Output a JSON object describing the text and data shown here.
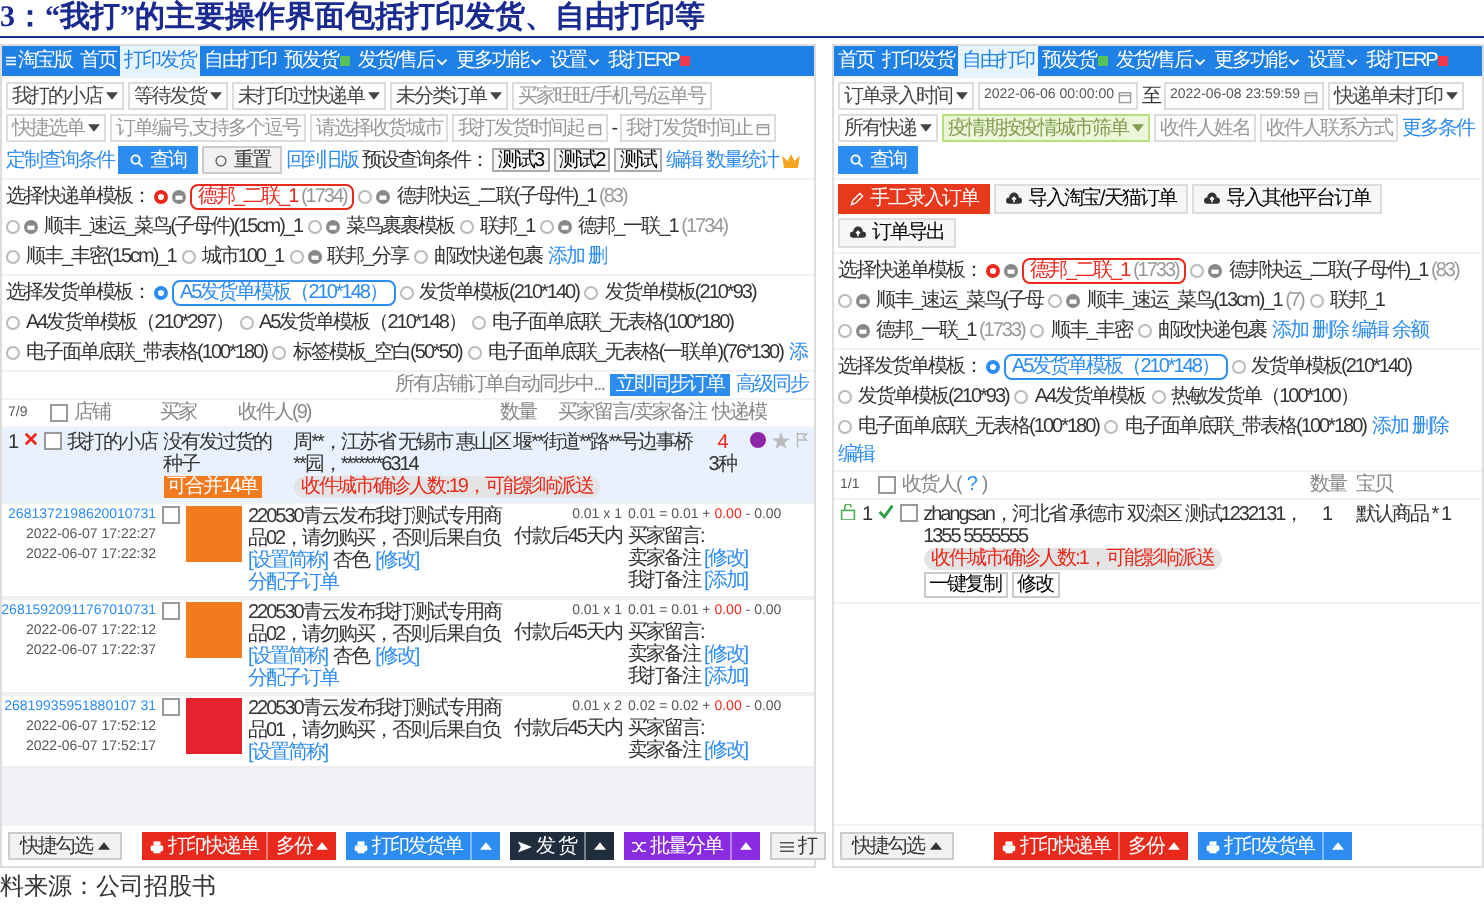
{
  "title": "3：“我打”的主要操作界面包括打印发货、自由打印等",
  "left": {
    "nav": {
      "logo": "淘宝版",
      "tabs": [
        {
          "label": "首页",
          "selected": false,
          "dropdown": false
        },
        {
          "label": "打印发货",
          "selected": true,
          "dropdown": false
        },
        {
          "label": "自由打印",
          "selected": false,
          "dropdown": false
        },
        {
          "label": "预发货",
          "selected": false,
          "dropdown": false,
          "badge": {
            "color": "#59c15a"
          }
        },
        {
          "label": "发货/售后",
          "selected": false,
          "dropdown": true
        },
        {
          "label": "更多功能",
          "selected": false,
          "dropdown": true
        },
        {
          "label": "设置",
          "selected": false,
          "dropdown": true
        },
        {
          "label": "我打ERP",
          "selected": false,
          "dropdown": false,
          "badge": {
            "color": "#ee3a4a"
          }
        }
      ]
    },
    "filters": [
      {
        "kind": "select",
        "value": "我打的小店"
      },
      {
        "kind": "select",
        "value": "等待发货"
      },
      {
        "kind": "select",
        "value": "未打印过快递单"
      },
      {
        "kind": "select",
        "value": "未分类订单"
      },
      {
        "kind": "input",
        "placeholder": "买家旺旺/手机号/运单号"
      },
      {
        "kind": "select",
        "placeholder": "快捷选单"
      },
      {
        "kind": "input",
        "placeholder": "订单编号,支持多个逗号"
      },
      {
        "kind": "input",
        "placeholder": "请选择收货城市"
      },
      {
        "kind": "date",
        "placeholder": "我打发货时间起"
      },
      {
        "kind": "sep",
        "text": "-"
      },
      {
        "kind": "date",
        "placeholder": "我打发货时间止"
      },
      {
        "kind": "link",
        "text": "定制查询条件"
      },
      {
        "kind": "primary",
        "text": "查询"
      },
      {
        "kind": "reset",
        "text": "重置"
      },
      {
        "kind": "link",
        "text": "回到旧版"
      }
    ],
    "presets": {
      "label": "预设查询条件：",
      "chips": [
        "测试3",
        "测试2",
        "测试"
      ],
      "links": [
        "编辑",
        "数量统计"
      ]
    },
    "express": {
      "label": "选择快递单模板：",
      "items": [
        {
          "kind": "iconed",
          "label": "德邦_二联_1",
          "count": "(1734)",
          "selected": true
        },
        {
          "kind": "iconed",
          "label": "德邦快运_二联(子母件)_1",
          "count": "(83)",
          "selected": false
        },
        {
          "kind": "iconed",
          "label": "顺丰_速运_菜鸟(子母件)(15cm)_1",
          "selected": false
        },
        {
          "kind": "iconed",
          "label": "菜鸟裹裹模板",
          "selected": false
        },
        {
          "kind": "plain",
          "label": "联邦_1",
          "selected": false
        },
        {
          "kind": "iconed",
          "label": "德邦_一联_1",
          "count": "(1734)",
          "selected": false
        },
        {
          "kind": "plain",
          "label": "顺丰_丰密(15cm)_1",
          "selected": false
        },
        {
          "kind": "plain",
          "label": "城市100_1",
          "selected": false
        },
        {
          "kind": "iconed",
          "label": "联邦_分享",
          "selected": false
        },
        {
          "kind": "plain",
          "label": "邮政快递包裹",
          "selected": false
        },
        {
          "kind": "link",
          "label": "添加"
        },
        {
          "kind": "link",
          "label": "删"
        }
      ]
    },
    "invoice": {
      "label": "选择发货单模板：",
      "items": [
        {
          "kind": "plain",
          "label": "A5发货单模板（210*148）",
          "selected": true
        },
        {
          "kind": "plain",
          "label": "发货单模板(210*140)",
          "selected": false
        },
        {
          "kind": "plain",
          "label": "发货单模板(210*93)",
          "selected": false
        },
        {
          "kind": "plain",
          "label": "A4发货单模板（210*297）",
          "selected": false
        },
        {
          "kind": "plain",
          "label": "A5发货单模板（210*148）",
          "selected": false
        },
        {
          "kind": "plain",
          "label": "电子面单底联_无表格(100*180)",
          "selected": false
        },
        {
          "kind": "plain",
          "label": "电子面单底联_带表格(100*180)",
          "selected": false
        },
        {
          "kind": "plain",
          "label": "标签模板_空白(50*50)",
          "selected": false
        },
        {
          "kind": "plain",
          "label": "电子面单底联_无表格(一联单)(76*130)",
          "selected": false
        },
        {
          "kind": "link",
          "label": "添"
        }
      ]
    },
    "sync": {
      "status": "所有店铺订单自动同步中...",
      "button": "立即同步订单",
      "link": "高级同步"
    },
    "table": {
      "all_checked": false,
      "count": "7/9",
      "columns": [
        "店铺",
        "买家",
        "收件人(9)",
        "数量",
        "买家留言/卖家备注",
        "快递模"
      ]
    },
    "order": {
      "index": "1",
      "checked": false,
      "shop": "我打的小店",
      "buyer": "没有发过货的种子",
      "merge_tag": "可合并14单",
      "address": "周**，江苏省 无锡市 惠山区 堰**街道**路**号边事桥**园，*******6314",
      "quantity": "4",
      "kinds": "3种",
      "warning": "收件城市确诊人数:19，可能影响派送"
    },
    "items": [
      {
        "checked": false,
        "order_no": "2681372198620010731",
        "dates": [
          "2022-06-07 17:22:27",
          "2022-06-07 17:22:32"
        ],
        "color": "#f47a20",
        "desc": "220530青云发布我打测试专用商品02，请勿购买，否则后果自负",
        "short_link": "[设置简称]",
        "variant": "杏色",
        "edit_link": "[修改]",
        "split_link": "分配子订单",
        "price": "0.01 x 1",
        "pay_term": "付款后45天内",
        "sum": "0.01 = 0.01 +",
        "discount": "0.00",
        "tail": "- 0.00",
        "notes": [
          {
            "label": "买家留言:"
          },
          {
            "label": "卖家备注",
            "link": "[修改]"
          },
          {
            "label": "我打备注",
            "link": "[添加]"
          }
        ]
      },
      {
        "checked": false,
        "order_no": "26815920911767010731",
        "dates": [
          "2022-06-07 17:22:12",
          "2022-06-07 17:22:37"
        ],
        "color": "#f47a20",
        "desc": "220530青云发布我打测试专用商品02，请勿购买，否则后果自负",
        "short_link": "[设置简称]",
        "variant": "杏色",
        "edit_link": "[修改]",
        "split_link": "分配子订单",
        "price": "0.01 x 1",
        "pay_term": "付款后45天内",
        "sum": "0.01 = 0.01 +",
        "discount": "0.00",
        "tail": "- 0.00",
        "notes": [
          {
            "label": "买家留言:"
          },
          {
            "label": "卖家备注",
            "link": "[修改]"
          },
          {
            "label": "我打备注",
            "link": "[添加]"
          }
        ]
      },
      {
        "checked": false,
        "order_no": "26819935951880107 31",
        "dates": [
          "2022-06-07 17:52:12",
          "2022-06-07 17:52:17"
        ],
        "color": "#e8212e",
        "desc": "220530青云发布我打测试专用商品01，请勿购买，否则后果自负",
        "short_link": "[设置简称]",
        "price": "0.01 x 2",
        "pay_term": "付款后45天内",
        "sum": "0.02 = 0.02 +",
        "discount": "0.00",
        "tail": "- 0.00",
        "notes": [
          {
            "label": "买家留言:"
          },
          {
            "label": "卖家备注",
            "link": "[修改]"
          }
        ]
      }
    ],
    "actions": {
      "quick": "快捷勾选",
      "buttons": [
        {
          "kind": "print",
          "label": "打印快递单",
          "extra": "多份",
          "color": "#e8291c"
        },
        {
          "kind": "print",
          "label": "打印发货单",
          "color": "#2d8cf0"
        },
        {
          "kind": "send",
          "label": "发 货",
          "color": "#1f2d3d"
        },
        {
          "kind": "split",
          "label": "批量分单",
          "color": "#8a2be2"
        },
        {
          "kind": "list",
          "label": "打",
          "color": "#f2f2f2"
        }
      ]
    }
  },
  "right": {
    "nav": {
      "tabs": [
        {
          "label": "首页",
          "selected": false,
          "dropdown": false
        },
        {
          "label": "打印发货",
          "selected": false,
          "dropdown": false
        },
        {
          "label": "自由打印",
          "selected": true,
          "dropdown": false
        },
        {
          "label": "预发货",
          "selected": false,
          "dropdown": false,
          "badge": {
            "color": "#59c15a"
          }
        },
        {
          "label": "发货/售后",
          "selected": false,
          "dropdown": true
        },
        {
          "label": "更多功能",
          "selected": false,
          "dropdown": true
        },
        {
          "label": "设置",
          "selected": false,
          "dropdown": true
        },
        {
          "label": "我打ERP",
          "selected": false,
          "dropdown": false,
          "badge": {
            "color": "#ee3a4a"
          }
        }
      ]
    },
    "filters": [
      {
        "kind": "select",
        "value": "订单录入时间"
      },
      {
        "kind": "date",
        "value": "2022-06-06 00:00:00"
      },
      {
        "kind": "sep",
        "text": "至"
      },
      {
        "kind": "date",
        "value": "2022-06-08 23:59:59"
      },
      {
        "kind": "select",
        "value": "快递单未打印"
      },
      {
        "kind": "select",
        "value": "所有快递"
      },
      {
        "kind": "green",
        "placeholder": "疫情期按疫情城市筛单"
      },
      {
        "kind": "input",
        "placeholder": "收件人姓名"
      },
      {
        "kind": "input",
        "placeholder": "收件人联系方式"
      },
      {
        "kind": "more",
        "text": "更多条件"
      },
      {
        "kind": "primary",
        "text": "查询"
      }
    ],
    "tools": [
      {
        "kind": "manual",
        "label": "手工录入订单"
      },
      {
        "kind": "import",
        "label": "导入淘宝/天猫订单"
      },
      {
        "kind": "import",
        "label": "导入其他平台订单"
      },
      {
        "kind": "import",
        "label": "订单导出"
      }
    ],
    "express": {
      "label": "选择快递单模板：",
      "items": [
        {
          "kind": "iconed",
          "label": "德邦_二联_1",
          "count": "(1733)",
          "selected": true
        },
        {
          "kind": "iconed",
          "label": "德邦快运_二联(子母件)_1",
          "count": "(83)",
          "selected": false
        },
        {
          "kind": "iconed",
          "label": "顺丰_速运_菜鸟(子母",
          "selected": false
        },
        {
          "kind": "iconed",
          "label": "顺丰_速运_菜鸟(13cm)_1",
          "count": "(7)",
          "selected": false
        },
        {
          "kind": "plain",
          "label": "联邦_1",
          "selected": false
        },
        {
          "kind": "iconed",
          "label": "德邦_一联_1",
          "count": "(1733)",
          "selected": false
        },
        {
          "kind": "plain",
          "label": "顺丰_丰密",
          "selected": false
        },
        {
          "kind": "plain",
          "label": "邮政快递包裹",
          "selected": false
        },
        {
          "kind": "link",
          "label": "添加"
        },
        {
          "kind": "link",
          "label": "删除"
        },
        {
          "kind": "link",
          "label": "编辑"
        },
        {
          "kind": "link",
          "label": "余额"
        }
      ]
    },
    "invoice": {
      "label": "选择发货单模板：",
      "items": [
        {
          "kind": "plain",
          "label": "A5发货单模板（210*148）",
          "selected": true
        },
        {
          "kind": "plain",
          "label": "发货单模板(210*140)",
          "selected": false
        },
        {
          "kind": "plain",
          "label": "发货单模板(210*93)",
          "selected": false
        },
        {
          "kind": "plain",
          "label": "A4发货单模板",
          "selected": false
        },
        {
          "kind": "plain",
          "label": "热敏发货单（100*100）",
          "selected": false
        },
        {
          "kind": "plain",
          "label": "电子面单底联_无表格(100*180)",
          "selected": false
        },
        {
          "kind": "plain",
          "label": "电子面单底联_带表格(100*180)",
          "selected": false
        },
        {
          "kind": "link",
          "label": "添加"
        },
        {
          "kind": "link",
          "label": "删除"
        },
        {
          "kind": "link",
          "label": "编辑"
        }
      ]
    },
    "table": {
      "all_checked": false,
      "count": "1/1",
      "receiver": "收货人(",
      "help": "?",
      "close": ")",
      "quantity": "数量",
      "goods": "宝贝"
    },
    "order": {
      "index": "1",
      "checked": false,
      "address": "zhangsan，河北省 承德市 双滦区 测试1232131，1355 5555555",
      "warning": "收件城市确诊人数:1，可能影响派送",
      "copy": "一键复制",
      "edit": "修改",
      "quantity": "1",
      "goods": "默认商品 * 1"
    },
    "actions": {
      "quick": "快捷勾选",
      "buttons": [
        {
          "kind": "print",
          "label": "打印快递单",
          "extra": "多份",
          "color": "#e8291c"
        },
        {
          "kind": "print",
          "label": "打印发货单",
          "color": "#2d8cf0"
        }
      ]
    }
  },
  "source": "料来源：公司招股书"
}
